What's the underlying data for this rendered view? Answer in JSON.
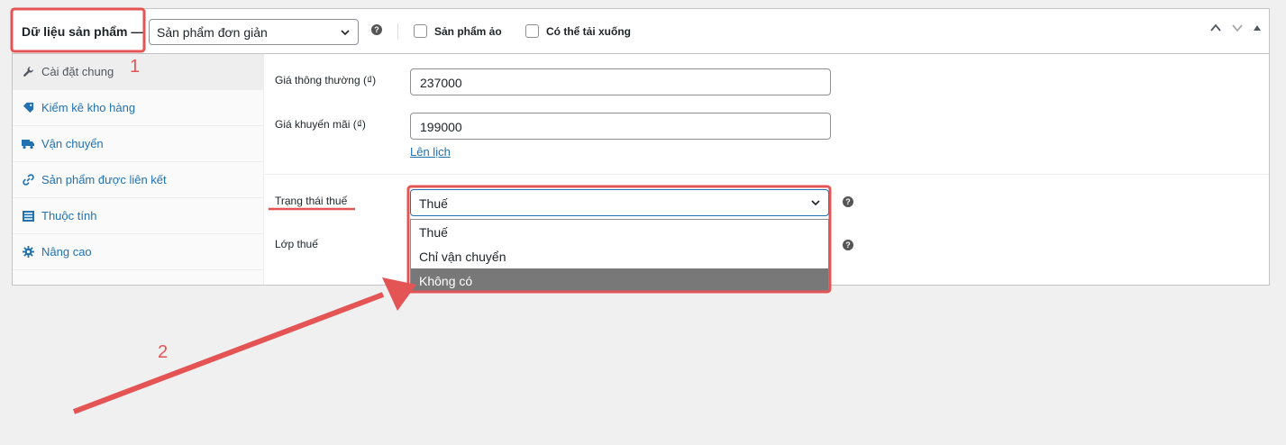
{
  "header": {
    "title": "Dữ liệu sản phẩm —",
    "product_type": "Sản phẩm đơn giản",
    "virtual_label": "Sản phẩm ảo",
    "downloadable_label": "Có thể tải xuống"
  },
  "tabs": [
    {
      "label": "Cài đặt chung",
      "icon": "wrench-icon",
      "active": true
    },
    {
      "label": "Kiểm kê kho hàng",
      "icon": "tag-icon"
    },
    {
      "label": "Vận chuyển",
      "icon": "truck-icon"
    },
    {
      "label": "Sản phẩm được liên kết",
      "icon": "link-icon"
    },
    {
      "label": "Thuộc tính",
      "icon": "list-icon"
    },
    {
      "label": "Nâng cao",
      "icon": "gear-icon"
    }
  ],
  "pricing": {
    "regular_label": "Giá thông thường (₫)",
    "regular_value": "237000",
    "sale_label": "Giá khuyến mãi (₫)",
    "sale_value": "199000",
    "schedule_link": "Lên lịch"
  },
  "tax": {
    "status_label": "Trạng thái thuế",
    "status_value": "Thuế",
    "class_label": "Lớp thuế",
    "options": [
      "Thuế",
      "Chỉ vận chuyển",
      "Không có"
    ],
    "highlighted_option": 2
  },
  "annotations": {
    "num1": "1",
    "num2": "2",
    "color": "#e55454"
  },
  "colors": {
    "accent": "#2271b1",
    "highlight_bg": "#787878"
  }
}
